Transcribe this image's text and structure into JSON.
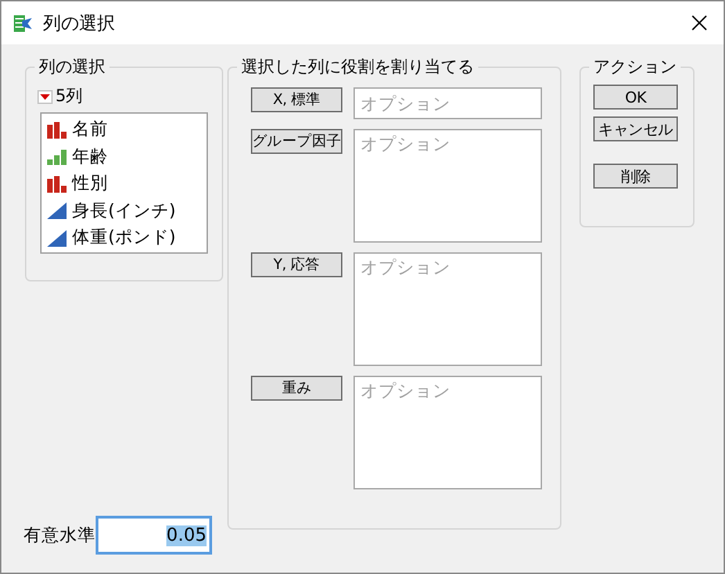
{
  "window": {
    "title": "列の選択"
  },
  "column_selection": {
    "title": "列の選択",
    "count_label": "5列",
    "columns": [
      {
        "name": "名前",
        "kind": "nominal"
      },
      {
        "name": "年齢",
        "kind": "ordinal"
      },
      {
        "name": "性別",
        "kind": "nominal"
      },
      {
        "name": "身長(インチ)",
        "kind": "continuous"
      },
      {
        "name": "体重(ポンド)",
        "kind": "continuous"
      }
    ]
  },
  "roles": {
    "title": "選択した列に役割を割り当てる",
    "rows": [
      {
        "button": "X, 標準",
        "placeholder": "オプション",
        "kind": "single"
      },
      {
        "button": "グループ因子",
        "placeholder": "オプション",
        "kind": "multi"
      },
      {
        "button": "Y, 応答",
        "placeholder": "オプション",
        "kind": "multi"
      },
      {
        "button": "重み",
        "placeholder": "オプション",
        "kind": "multi"
      }
    ]
  },
  "actions": {
    "title": "アクション",
    "buttons": [
      {
        "label": "OK",
        "kind": "normal"
      },
      {
        "label": "キャンセル",
        "kind": "normal"
      },
      {
        "label": "削除",
        "kind": "spaced"
      }
    ]
  },
  "significance": {
    "label": "有意水準",
    "value": "0.05",
    "focused": true
  }
}
